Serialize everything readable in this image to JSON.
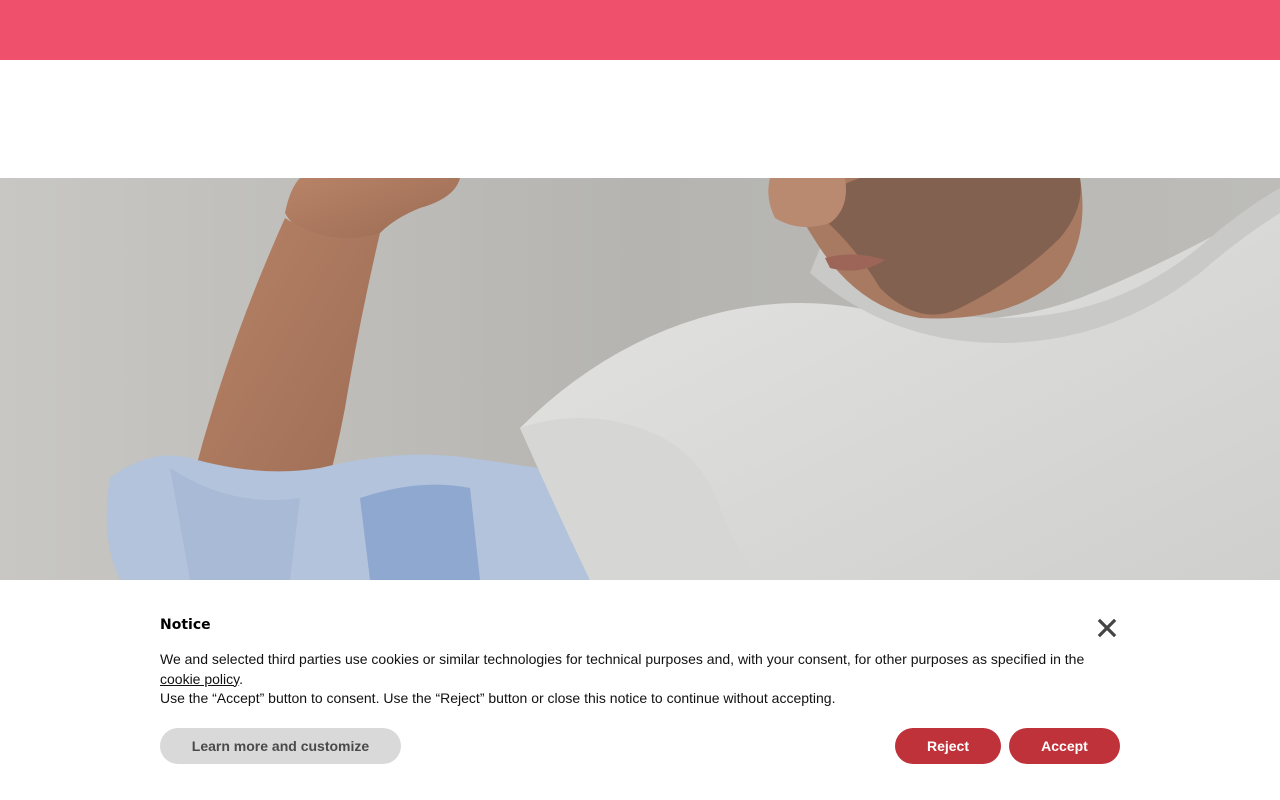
{
  "colors": {
    "top_bar": "#ef506b",
    "button_primary": "#c0323a",
    "button_secondary": "#d9d9d9"
  },
  "hero": {
    "image": "man-sniffing-armpit-white-tshirt-photo"
  },
  "cookie_notice": {
    "title": "Notice",
    "close_icon": "close-icon",
    "text_part1": "We and selected third parties use cookies or similar technologies for technical purposes and, with your consent, for other purposes as specified in the ",
    "policy_link": "cookie policy",
    "text_part2": ".",
    "text_line2": "Use the “Accept” button to consent. Use the “Reject” button or close this notice to continue without accepting.",
    "learn_more_label": "Learn more and customize",
    "reject_label": "Reject",
    "accept_label": "Accept"
  }
}
